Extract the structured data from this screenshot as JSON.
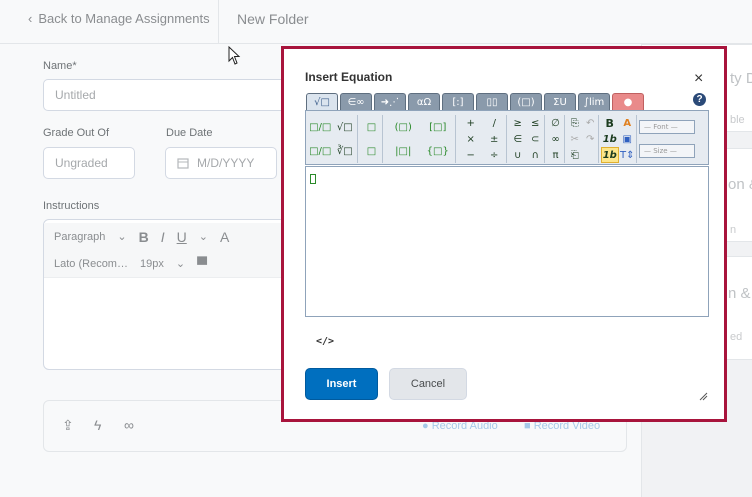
{
  "header": {
    "back_label": "Back to Manage Assignments",
    "folder_name": "New Folder"
  },
  "form": {
    "name_label": "Name",
    "name_required": "*",
    "name_placeholder": "Untitled",
    "grade_label": "Grade Out Of",
    "grade_placeholder": "Ungraded",
    "due_label": "Due Date",
    "due_placeholder": "M/D/YYYY",
    "instructions_label": "Instructions",
    "toolbar": {
      "format": "Paragraph",
      "font": "Lato (Recom…",
      "size": "19px"
    },
    "record_audio": "Record Audio",
    "record_video": "Record Video"
  },
  "right_panel": {
    "h1": "ty D",
    "s1": "ble",
    "h2": "on &",
    "s2": "n",
    "h3": "n &",
    "s3": "ed"
  },
  "dialog": {
    "title": "Insert Equation",
    "close_icon": "×",
    "help_icon": "?",
    "tabs": [
      "√□",
      "∈∞",
      "➜⋰",
      "αΩ",
      "[:]",
      "▯▯",
      "(□)",
      "ΣU",
      "∫lim",
      "●"
    ],
    "palette": {
      "templates1": [
        "□/□",
        "√□",
        "□/□",
        "∛□"
      ],
      "templates2": [
        "□",
        "□",
        "□",
        "□"
      ],
      "fences": [
        "(□)",
        "[□]",
        "|□|",
        "{□}"
      ],
      "ops": [
        "+",
        "/",
        "≥",
        "≤",
        "×",
        "±",
        "∈",
        "⊂",
        "−",
        "÷",
        "∪",
        "∩"
      ],
      "misc": [
        "∅",
        "∞",
        "π"
      ],
      "edit": [
        "B",
        "A",
        "1b",
        "1b"
      ],
      "font_select": "— Font —",
      "size_select": "— Size —"
    },
    "code_toggle": "</>",
    "insert_label": "Insert",
    "cancel_label": "Cancel"
  }
}
